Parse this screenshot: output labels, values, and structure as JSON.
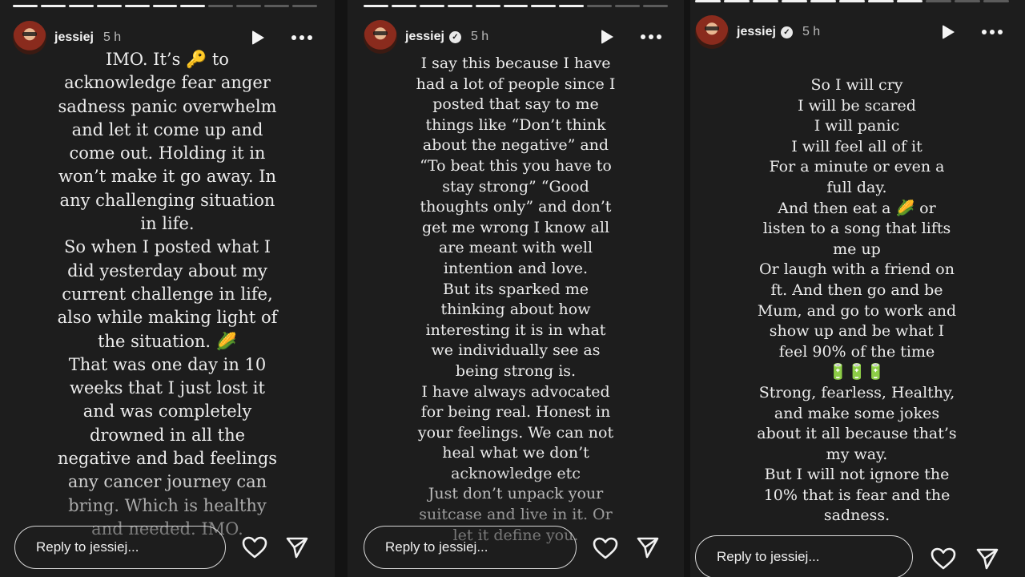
{
  "stories": [
    {
      "username": "jessiej",
      "time": "5 h",
      "text": "IMO. It’s 🔑 to\nacknowledge fear anger\nsadness panic overwhelm\nand let it come up and\ncome out. Holding it in\nwon’t make it go away. In\nany challenging situation\nin life.\nSo when I posted what I\ndid yesterday about my\ncurrent challenge in life,\nalso while making light of\nthe situation. 🌽\nThat was one day in 10\nweeks that I just lost it\nand was completely\ndrowned in all the\nnegative and bad feelings\nany cancer journey can\nbring. Which is healthy\nand needed. IMO.",
      "reply_placeholder": "Reply to jessiej..."
    },
    {
      "username": "jessiej",
      "time": "5 h",
      "text": "I say this because I have\nhad a lot of people since I\nposted that say to me\nthings like “Don’t think\nabout the negative” and\n“To beat this you have to\nstay strong” “Good\nthoughts only” and don’t\nget me wrong I know all\nare meant with well\nintention and love.\nBut its sparked me\nthinking about how\ninteresting it is in what\nwe individually see as\nbeing strong is.\nI have always advocated\nfor being real. Honest in\nyour feelings. We can not\nheal what we don’t\nacknowledge etc\nJust don’t unpack your\nsuitcase and live in it. Or\nlet it define you.",
      "reply_placeholder": "Reply to jessiej..."
    },
    {
      "username": "jessiej",
      "time": "5 h",
      "text": "So I will cry\nI will be scared\nI will panic\nI will feel all of it\nFor a minute or even a\nfull day.\nAnd then eat a 🌽 or\nlisten to a song that lifts\nme up\nOr laugh with a friend on\nft. And then go and be\nMum, and go to work and\nshow up and be what I\nfeel 90% of the time\n🔋🔋🔋\nStrong, fearless, Healthy,\nand make some jokes\nabout it all because that’s\nmy way.\nBut I will not ignore the\n10% that is fear and the\nsadness.",
      "reply_placeholder": "Reply to jessiej..."
    }
  ],
  "icons": {
    "play": "play-icon",
    "more": "more-options-icon",
    "heart": "heart-icon",
    "send": "send-icon",
    "verified": "verified-badge-icon"
  },
  "colors": {
    "panel_bg": "#1d1d1d",
    "page_bg": "#131313",
    "text": "#ececec"
  }
}
